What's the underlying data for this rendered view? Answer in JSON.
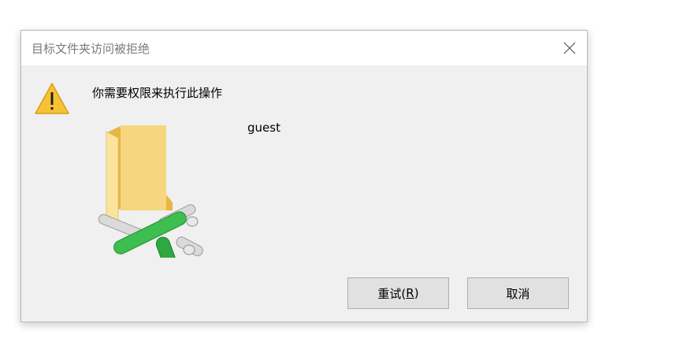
{
  "dialog": {
    "title": "目标文件夹访问被拒绝",
    "message": "你需要权限来执行此操作",
    "user": "guest",
    "buttons": {
      "retry_label": "重试(",
      "retry_mnemonic": "R",
      "retry_suffix": ")",
      "cancel_label": "取消"
    },
    "icons": {
      "close": "close-icon",
      "warning": "warning-icon",
      "network_folder": "network-folder-icon"
    }
  }
}
